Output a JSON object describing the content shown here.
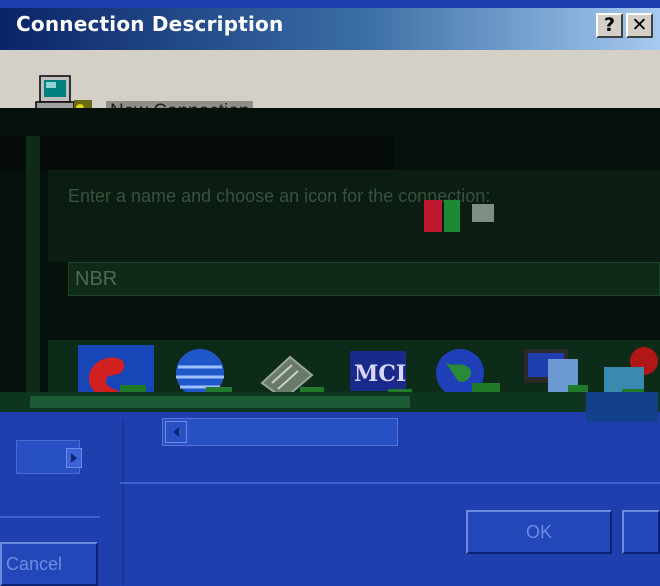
{
  "window": {
    "title": "Connection Description",
    "help_button": "?",
    "close_button": "✕"
  },
  "header": {
    "connection_name": "New Connection",
    "icon": "connection-computer-icon"
  },
  "body": {
    "prompt": "Enter a name and choose an icon for the connection:",
    "name_value": "NBR",
    "icon_options": [
      "att-icon",
      "globe-icon",
      "phone-icon",
      "mci-icon",
      "globe-network-icon",
      "computer-icon",
      "file-icon",
      "red-icon"
    ]
  },
  "buttons": {
    "ok": "OK",
    "cancel": "Cancel"
  },
  "colors": {
    "title_bar_start": "#0a246a",
    "title_bar_end": "#a6caf0",
    "dialog_face": "#d4d0c8",
    "selected_icon": "#1646b8"
  }
}
